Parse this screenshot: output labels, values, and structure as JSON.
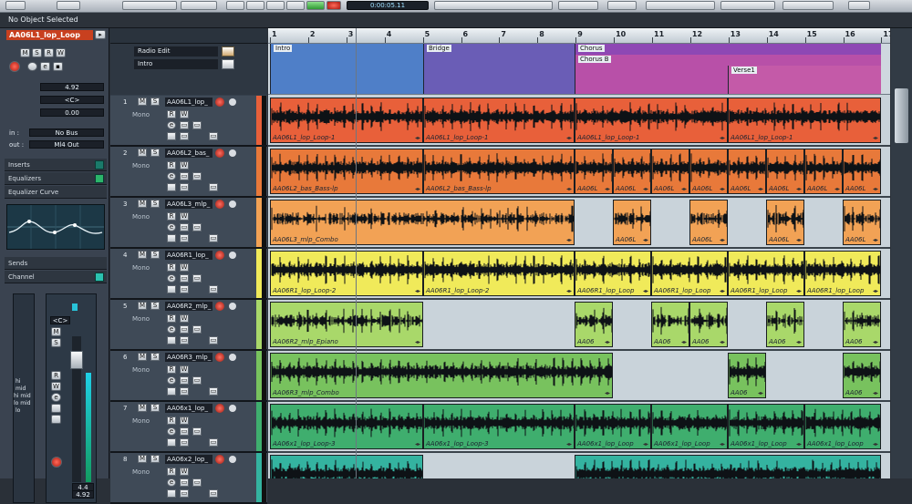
{
  "toolbar": {
    "time_display": "0:00:05.11",
    "status_text": "No Object Selected"
  },
  "inspector": {
    "track_name": "AA06L1_lop_Loop",
    "volume": "4.92",
    "pan": "<C>",
    "delay": "0.00",
    "input_routing": "No Bus",
    "output_routing": "Ml4 Out",
    "in_label": "in :",
    "out_label": "out :",
    "sections": [
      "Inserts",
      "Equalizers",
      "Equalizer Curve",
      "Sends",
      "Channel"
    ],
    "fader_pan": "<C>",
    "fader_value": "4.92",
    "fader_top_value": "4.4",
    "eq_bands": [
      "hi",
      "mid",
      "hi mid",
      "lo mid",
      "lo"
    ]
  },
  "tracklist": {
    "button_m": "M",
    "button_s": "S",
    "button_r": "R",
    "button_w": "W",
    "button_e": "e",
    "mono_label": "Mono",
    "preset_label": "Radio Edit",
    "marker_label": "Intro",
    "tracks": [
      {
        "num": "1",
        "name": "AA06L1_lop_",
        "color": "#e8603a"
      },
      {
        "num": "2",
        "name": "AA06L2_bas_",
        "color": "#e8793a"
      },
      {
        "num": "3",
        "name": "AA06L3_mlp_",
        "color": "#f2a255"
      },
      {
        "num": "4",
        "name": "AA06R1_lop_",
        "color": "#f0ea5a"
      },
      {
        "num": "5",
        "name": "AA06R2_mlp_",
        "color": "#a9d86a"
      },
      {
        "num": "6",
        "name": "AA06R3_mlp_",
        "color": "#78c25e"
      },
      {
        "num": "7",
        "name": "AA06x1_lop_",
        "color": "#3fae6e"
      },
      {
        "num": "8",
        "name": "AA06x2_lop_",
        "color": "#34b3a0"
      }
    ]
  },
  "ruler": {
    "bars": [
      "1",
      "2",
      "3",
      "4",
      "5",
      "6",
      "7",
      "8",
      "9",
      "10",
      "11",
      "12",
      "13",
      "14",
      "15",
      "16",
      "17"
    ]
  },
  "markers": [
    {
      "label": "Intro",
      "color": "#4f7fc8"
    },
    {
      "label": "Bridge",
      "color": "#6a5db6"
    },
    {
      "label": "Chorus",
      "color": "#8e48b4"
    },
    {
      "label": "Chorus B",
      "color": "#b850a8"
    },
    {
      "label": "Verse1",
      "color": "#c45aa8"
    }
  ],
  "events": [
    {
      "track": 0,
      "items": [
        {
          "label": "AA06L1_lop_Loop-1"
        },
        {
          "label": "AA06L1_lop_Loop-1"
        },
        {
          "label": "AA06L1_lop_Loop-1"
        },
        {
          "label": "AA06L1_lop_Loop-1"
        }
      ]
    },
    {
      "track": 1,
      "items": [
        {
          "label": "AA06L2_bas_Bass-lp"
        },
        {
          "label": "AA06L2_bas_Bass-lp"
        },
        {
          "label": "AA06L"
        },
        {
          "label": "AA06L"
        },
        {
          "label": "AA06L"
        },
        {
          "label": "AA06L"
        },
        {
          "label": "AA06L"
        },
        {
          "label": "AA06L"
        },
        {
          "label": "AA06L"
        },
        {
          "label": "AA06L"
        }
      ]
    },
    {
      "track": 2,
      "items": [
        {
          "label": "AA06L3_mlp_Combo"
        },
        {
          "label": "AA06L"
        },
        {
          "label": "AA06L"
        },
        {
          "label": "AA06L"
        },
        {
          "label": "AA06L"
        }
      ]
    },
    {
      "track": 3,
      "items": [
        {
          "label": "AA06R1_lop_Loop-2"
        },
        {
          "label": "AA06R1_lop_Loop-2"
        },
        {
          "label": "AA06R1_lop_Loop"
        },
        {
          "label": "AA06R1_lop_Loop"
        },
        {
          "label": "AA06R1_lop_Loop"
        },
        {
          "label": "AA06R1_lop_Loop"
        }
      ]
    },
    {
      "track": 4,
      "items": [
        {
          "label": "AA06R2_mlp_Epiano"
        },
        {
          "label": "AA06"
        },
        {
          "label": "AA06"
        },
        {
          "label": "AA06"
        },
        {
          "label": "AA06"
        },
        {
          "label": "AA06"
        }
      ]
    },
    {
      "track": 5,
      "items": [
        {
          "label": "AA06R3_mlp_Combo"
        },
        {
          "label": "AA06"
        },
        {
          "label": "AA06"
        }
      ]
    },
    {
      "track": 6,
      "items": [
        {
          "label": "AA06x1_lop_Loop-3"
        },
        {
          "label": "AA06x1_lop_Loop-3"
        },
        {
          "label": "AA06x1_lop_Loop"
        },
        {
          "label": "AA06x1_lop_Loop"
        },
        {
          "label": "AA06x1_lop_Loop"
        },
        {
          "label": "AA06x1_lop_Loop"
        }
      ]
    },
    {
      "track": 7,
      "items": [
        {
          "label": ""
        },
        {
          "label": ""
        }
      ]
    }
  ]
}
